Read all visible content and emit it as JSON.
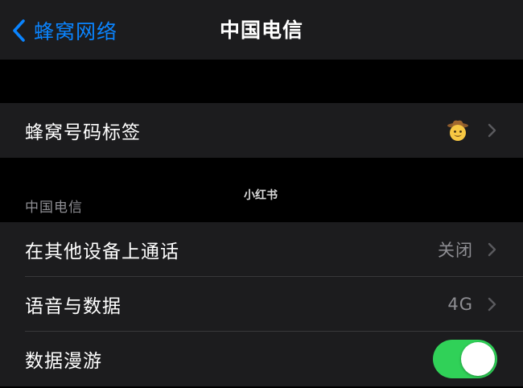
{
  "nav": {
    "back_label": "蜂窝网络",
    "title": "中国电信"
  },
  "label_group": {
    "cells": [
      {
        "label": "蜂窝号码标签",
        "icon": "cowboy-emoji-icon"
      }
    ]
  },
  "carrier_section": {
    "header": "中国电信",
    "watermark": "小红书",
    "cells": [
      {
        "label": "在其他设备上通话",
        "value": "关闭"
      },
      {
        "label": "语音与数据",
        "value": "4G"
      },
      {
        "label": "数据漫游",
        "toggle": true
      }
    ]
  },
  "colors": {
    "accent": "#0a84ff",
    "toggle_on": "#30d158",
    "cell_bg": "#1c1c1e",
    "secondary_text": "#8e8e93"
  }
}
